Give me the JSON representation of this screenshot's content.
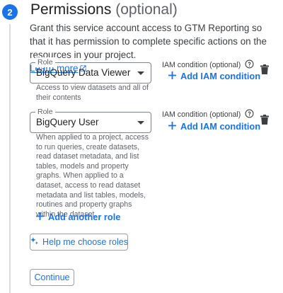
{
  "step": {
    "number": "2",
    "title": "Permissions",
    "title_suffix": "(optional)",
    "description": "Grant this service account access to GTM Reporting so that it has permission to complete specific actions on the resources in your project.",
    "learn_more": "Learn more"
  },
  "roles": [
    {
      "legend": "Role",
      "value": "BigQuery Data Viewer",
      "hint": "Access to view datasets and all of their contents",
      "iam_condition_label": "IAM condition (optional)",
      "add_iam_condition": "Add IAM condition"
    },
    {
      "legend": "Role",
      "value": "BigQuery User",
      "hint": "When applied to a project, access to run queries, create datasets, read dataset metadata, and list tables, models and property graphs. When applied to a dataset, access to read dataset metadata and list tables, models, routines and property graphs within the dataset.",
      "iam_condition_label": "IAM condition (optional)",
      "add_iam_condition": "Add IAM condition"
    }
  ],
  "add_another_role": "Add another role",
  "help_choose_roles": "Help me choose roles",
  "continue_label": "Continue",
  "colors": {
    "accent": "#1a73e8",
    "text": "#202124",
    "secondary_text": "#5f6368"
  },
  "icons": [
    "open-in-new-icon",
    "help-circle-icon",
    "plus-icon",
    "trash-icon",
    "sparkle-icon"
  ]
}
